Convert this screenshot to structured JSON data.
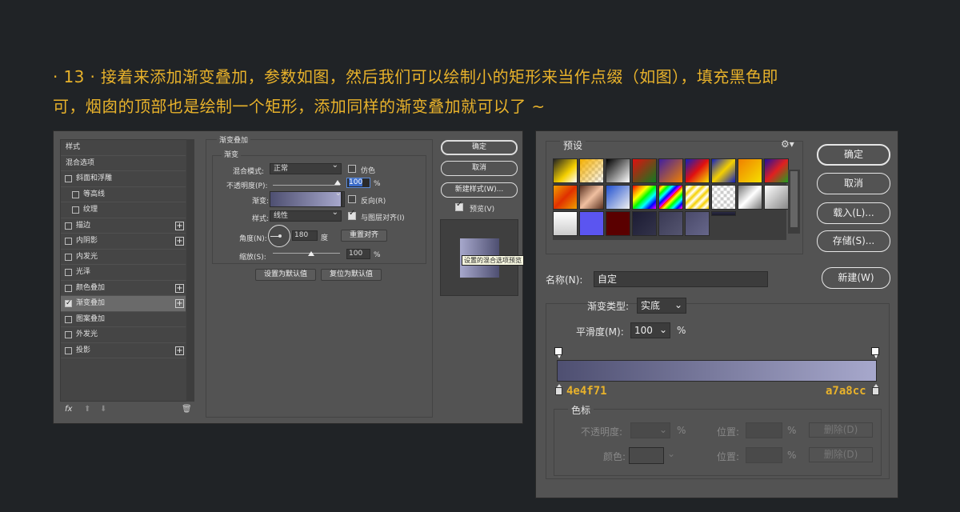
{
  "caption": {
    "line1": "· 13 · 接着来添加渐变叠加，参数如图，然后我们可以绘制小的矩形来当作点缀（如图），填充黑色即",
    "line2": "可，烟囱的顶部也是绘制一个矩形，添加同样的渐变叠加就可以了 ~"
  },
  "layer_style": {
    "list": {
      "title": "样式",
      "blend_options": "混合选项",
      "items": [
        {
          "label": "斜面和浮雕",
          "checked": false,
          "plus": false,
          "sub": false
        },
        {
          "label": "等高线",
          "checked": false,
          "plus": false,
          "sub": true
        },
        {
          "label": "纹理",
          "checked": false,
          "plus": false,
          "sub": true
        },
        {
          "label": "描边",
          "checked": false,
          "plus": true,
          "sub": false
        },
        {
          "label": "内阴影",
          "checked": false,
          "plus": true,
          "sub": false
        },
        {
          "label": "内发光",
          "checked": false,
          "plus": false,
          "sub": false
        },
        {
          "label": "光泽",
          "checked": false,
          "plus": false,
          "sub": false
        },
        {
          "label": "颜色叠加",
          "checked": false,
          "plus": true,
          "sub": false
        },
        {
          "label": "渐变叠加",
          "checked": true,
          "plus": true,
          "sub": false,
          "selected": true
        },
        {
          "label": "图案叠加",
          "checked": false,
          "plus": false,
          "sub": false
        },
        {
          "label": "外发光",
          "checked": false,
          "plus": false,
          "sub": false
        },
        {
          "label": "投影",
          "checked": false,
          "plus": true,
          "sub": false
        }
      ],
      "fx": "fx"
    },
    "panel": {
      "title": "渐变叠加",
      "subtitle": "渐变",
      "blend_mode_label": "混合模式:",
      "blend_mode": "正常",
      "dither_label": "仿色",
      "opacity_label": "不透明度(P):",
      "opacity": "100",
      "pct": "%",
      "gradient_label": "渐变:",
      "reverse_label": "反向(R)",
      "style_label": "样式:",
      "style": "线性",
      "align_label": "与图层对齐(I)",
      "angle_label": "角度(N):",
      "angle": "180",
      "deg": "度",
      "reset_align": "重置对齐",
      "scale_label": "缩放(S):",
      "scale": "100",
      "set_default": "设置为默认值",
      "reset_default": "复位为默认值"
    },
    "buttons": {
      "ok": "确定",
      "cancel": "取消",
      "new_style": "新建样式(W)...",
      "preview": "预览(V)"
    },
    "tooltip": "设置的混合选项预览"
  },
  "gradient_editor": {
    "presets_title": "预设",
    "gear": "gear-icon",
    "name_label": "名称(N):",
    "name_value": "自定",
    "type_label": "渐变类型:",
    "type_value": "实底",
    "smooth_label": "平滑度(M):",
    "smooth_value": "100",
    "pct": "%",
    "start_hex": "4e4f71",
    "end_hex": "a7a8cc",
    "stops_title": "色标",
    "opacity_label": "不透明度:",
    "location_label": "位置:",
    "color_label": "颜色:",
    "delete_label": "删除(D)",
    "buttons": {
      "ok": "确定",
      "cancel": "取消",
      "load": "载入(L)...",
      "save": "存储(S)...",
      "new": "新建(W)"
    },
    "colors": {
      "start": "#4e4f71",
      "end": "#a7a8cc",
      "accent": "#e8b22b"
    }
  }
}
